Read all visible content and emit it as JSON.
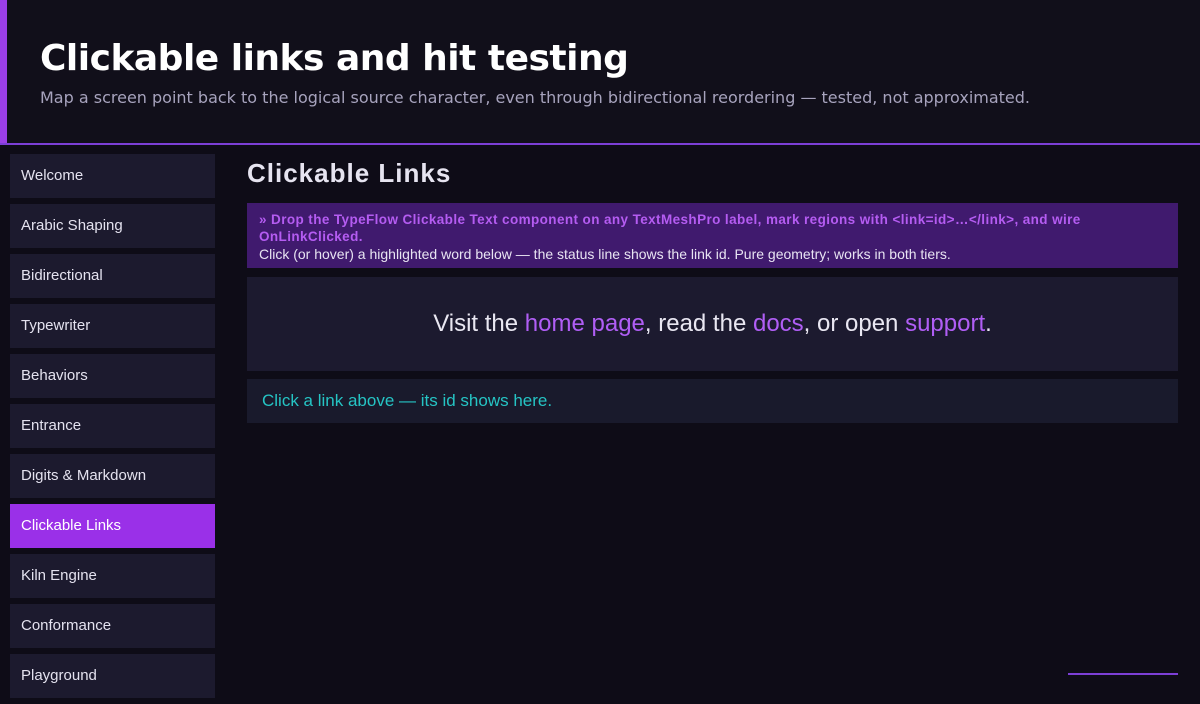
{
  "header": {
    "title": "Clickable links and hit testing",
    "subtitle": "Map a screen point back to the logical source character, even through bidirectional reordering — tested, not approximated."
  },
  "sidebar": {
    "items": [
      {
        "label": "Welcome",
        "active": false
      },
      {
        "label": "Arabic Shaping",
        "active": false
      },
      {
        "label": "Bidirectional",
        "active": false
      },
      {
        "label": "Typewriter",
        "active": false
      },
      {
        "label": "Behaviors",
        "active": false
      },
      {
        "label": "Entrance",
        "active": false
      },
      {
        "label": "Digits & Markdown",
        "active": false
      },
      {
        "label": "Clickable Links",
        "active": true
      },
      {
        "label": "Kiln Engine",
        "active": false
      },
      {
        "label": "Conformance",
        "active": false
      },
      {
        "label": "Playground",
        "active": false
      }
    ]
  },
  "main": {
    "title": "Clickable Links",
    "info": {
      "line1": "» Drop the TypeFlow Clickable Text component on any TextMeshPro label, mark regions with <link=id>…</link>, and wire OnLinkClicked.",
      "line2": "Click (or hover) a highlighted word below — the status line shows the link id. Pure geometry; works in both tiers."
    },
    "demo": {
      "t1": "Visit the ",
      "link_home": "home page",
      "t2": ", read the ",
      "link_docs": "docs",
      "t3": ", or open ",
      "link_support": "support",
      "t4": "."
    },
    "status": "Click a link above — its id shows here."
  },
  "colors": {
    "accent": "#9a30e8",
    "link": "#b05ef5",
    "status_text": "#25c4c4",
    "info_bg": "#401a6e"
  }
}
